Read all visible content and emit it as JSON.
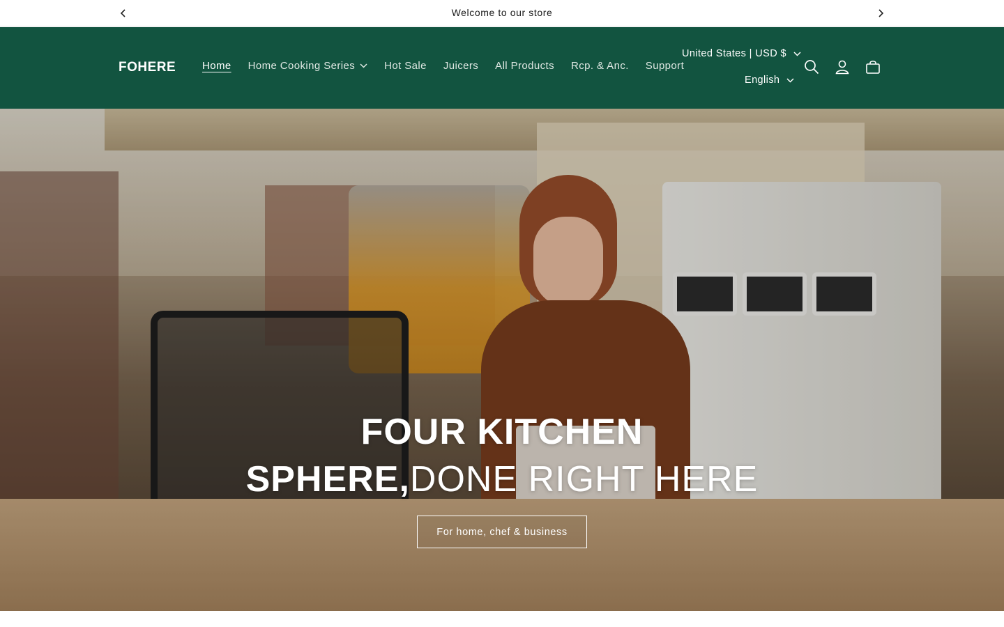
{
  "announcement": {
    "message": "Welcome to our store"
  },
  "header": {
    "logo": "FOHERE",
    "nav": [
      {
        "label": "Home",
        "active": true,
        "has_dropdown": false
      },
      {
        "label": "Home Cooking Series",
        "active": false,
        "has_dropdown": true
      },
      {
        "label": "Hot Sale",
        "active": false,
        "has_dropdown": false
      },
      {
        "label": "Juicers",
        "active": false,
        "has_dropdown": false
      },
      {
        "label": "All Products",
        "active": false,
        "has_dropdown": false
      },
      {
        "label": "Rcp. & Anc.",
        "active": false,
        "has_dropdown": false
      },
      {
        "label": "Support",
        "active": false,
        "has_dropdown": false
      }
    ],
    "country_currency": "United States | USD $",
    "language": "English",
    "icons": [
      "search-icon",
      "account-icon",
      "cart-icon"
    ]
  },
  "hero": {
    "title_line1": "FOUR KITCHEN",
    "title_line2_bold": "SPHERE,",
    "title_line2_thin": "DONE RIGHT HERE",
    "button_label": "For home, chef & business"
  },
  "colors": {
    "header_bg": "#125440",
    "header_text": "#ffffff",
    "announcement_bg": "#ffffff"
  }
}
